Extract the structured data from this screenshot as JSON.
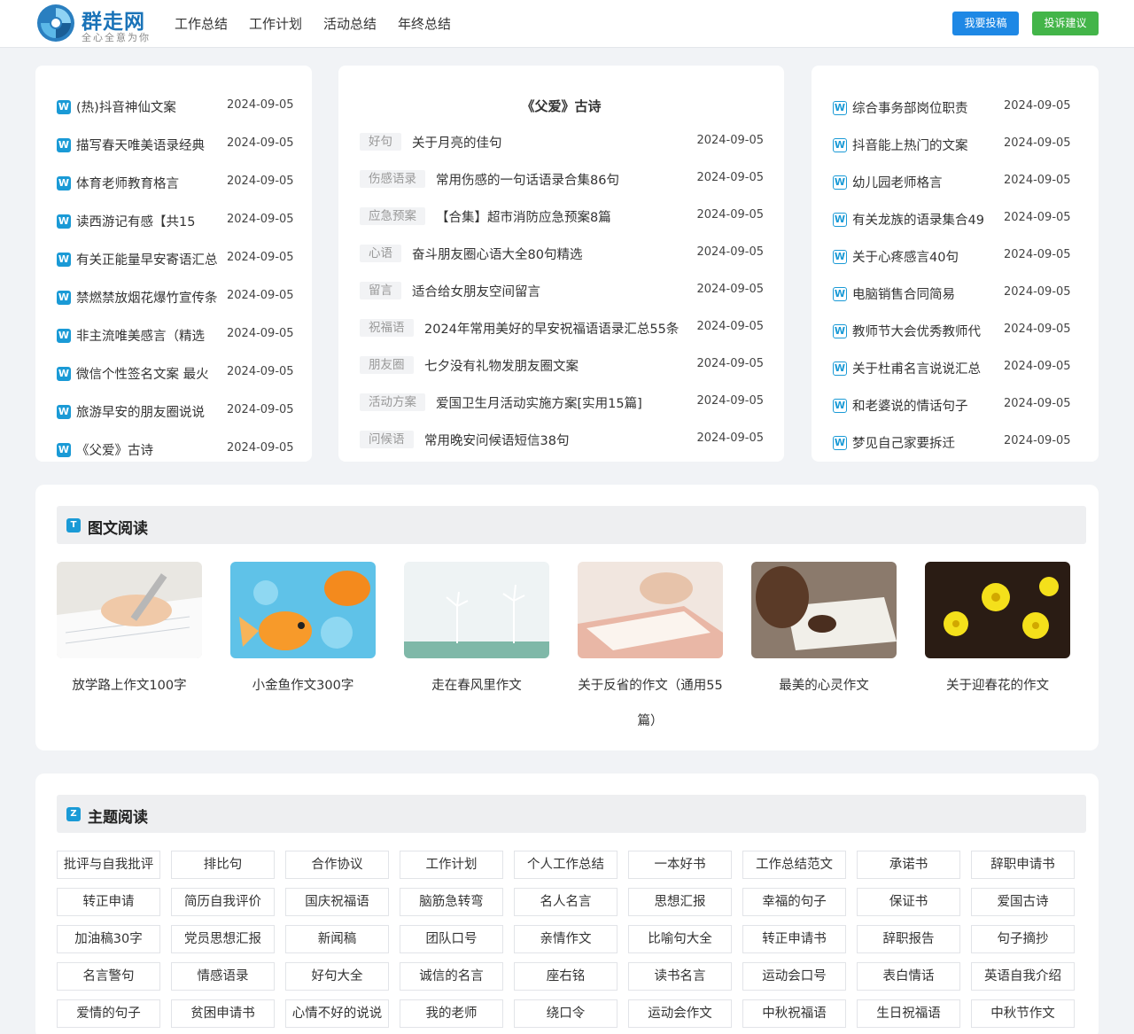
{
  "header": {
    "logo_title": "群走网",
    "logo_slogan": "全心全意为你",
    "nav": [
      "工作总结",
      "工作计划",
      "活动总结",
      "年终总结"
    ],
    "btn_submit": "我要投稿",
    "btn_feedback": "投诉建议"
  },
  "left_list": [
    {
      "title": "(热)抖音神仙文案",
      "date": "2024-09-05"
    },
    {
      "title": "描写春天唯美语录经典",
      "date": "2024-09-05"
    },
    {
      "title": "体育老师教育格言",
      "date": "2024-09-05"
    },
    {
      "title": "读西游记有感【共15",
      "date": "2024-09-05"
    },
    {
      "title": "有关正能量早安寄语汇总",
      "date": "2024-09-05"
    },
    {
      "title": "禁燃禁放烟花爆竹宣传条",
      "date": "2024-09-05"
    },
    {
      "title": "非主流唯美感言（精选",
      "date": "2024-09-05"
    },
    {
      "title": "微信个性签名文案 最火",
      "date": "2024-09-05"
    },
    {
      "title": "旅游早安的朋友圈说说",
      "date": "2024-09-05"
    },
    {
      "title": "《父爱》古诗",
      "date": "2024-09-05"
    }
  ],
  "mid": {
    "title": "《父爱》古诗",
    "items": [
      {
        "tag": "好句",
        "title": "关于月亮的佳句",
        "date": "2024-09-05"
      },
      {
        "tag": "伤感语录",
        "title": "常用伤感的一句话语录合集86句",
        "date": "2024-09-05"
      },
      {
        "tag": "应急预案",
        "title": "【合集】超市消防应急预案8篇",
        "date": "2024-09-05"
      },
      {
        "tag": "心语",
        "title": "奋斗朋友圈心语大全80句精选",
        "date": "2024-09-05"
      },
      {
        "tag": "留言",
        "title": "适合给女朋友空间留言",
        "date": "2024-09-05"
      },
      {
        "tag": "祝福语",
        "title": "2024年常用美好的早安祝福语语录汇总55条",
        "date": "2024-09-05"
      },
      {
        "tag": "朋友圈",
        "title": "七夕没有礼物发朋友圈文案",
        "date": "2024-09-05"
      },
      {
        "tag": "活动方案",
        "title": "爱国卫生月活动实施方案[实用15篇]",
        "date": "2024-09-05"
      },
      {
        "tag": "问候语",
        "title": "常用晚安问候语短信38句",
        "date": "2024-09-05"
      }
    ]
  },
  "right_list": [
    {
      "title": "综合事务部岗位职责",
      "date": "2024-09-05"
    },
    {
      "title": "抖音能上热门的文案",
      "date": "2024-09-05"
    },
    {
      "title": "幼儿园老师格言",
      "date": "2024-09-05"
    },
    {
      "title": "有关龙族的语录集合49",
      "date": "2024-09-05"
    },
    {
      "title": "关于心疼感言40句",
      "date": "2024-09-05"
    },
    {
      "title": "电脑销售合同简易",
      "date": "2024-09-05"
    },
    {
      "title": "教师节大会优秀教师代",
      "date": "2024-09-05"
    },
    {
      "title": "关于杜甫名言说说汇总",
      "date": "2024-09-05"
    },
    {
      "title": "和老婆说的情话句子",
      "date": "2024-09-05"
    },
    {
      "title": "梦见自己家要拆迁",
      "date": "2024-09-05"
    }
  ],
  "pic_section": {
    "badge": "T",
    "title": "图文阅读",
    "items": [
      {
        "caption": "放学路上作文100字"
      },
      {
        "caption": "小金鱼作文300字"
      },
      {
        "caption": "走在春风里作文"
      },
      {
        "caption": "关于反省的作文（通用55篇）"
      },
      {
        "caption": "最美的心灵作文"
      },
      {
        "caption": "关于迎春花的作文"
      }
    ]
  },
  "topic_section": {
    "badge": "Z",
    "title": "主题阅读",
    "tags": [
      "批评与自我批评",
      "排比句",
      "合作协议",
      "工作计划",
      "个人工作总结",
      "一本好书",
      "工作总结范文",
      "承诺书",
      "辞职申请书",
      "转正申请",
      "简历自我评价",
      "国庆祝福语",
      "脑筋急转弯",
      "名人名言",
      "思想汇报",
      "幸福的句子",
      "保证书",
      "爱国古诗",
      "加油稿30字",
      "党员思想汇报",
      "新闻稿",
      "团队口号",
      "亲情作文",
      "比喻句大全",
      "转正申请书",
      "辞职报告",
      "句子摘抄",
      "名言警句",
      "情感语录",
      "好句大全",
      "诚信的名言",
      "座右铭",
      "读书名言",
      "运动会口号",
      "表白情话",
      "英语自我介绍",
      "爱情的句子",
      "贫困申请书",
      "心情不好的说说",
      "我的老师",
      "绕口令",
      "运动会作文",
      "中秋祝福语",
      "生日祝福语",
      "中秋节作文"
    ]
  },
  "colors": {
    "brand": "#1a73b8",
    "accent": "#1a9ad6",
    "btn_blue": "#1e88e5",
    "btn_green": "#43b549"
  }
}
